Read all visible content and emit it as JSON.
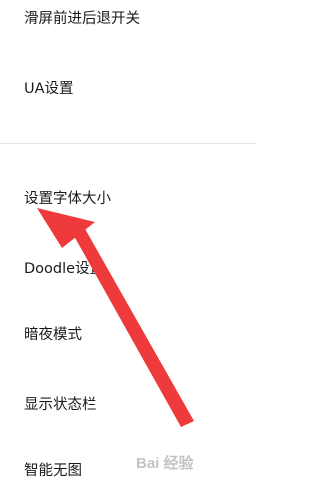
{
  "settings": {
    "items": [
      {
        "label": "滑屏前进后退开关"
      },
      {
        "label": "UA设置"
      },
      {
        "label": "设置字体大小"
      },
      {
        "label": "Doodle设置"
      },
      {
        "label": "暗夜模式"
      },
      {
        "label": "显示状态栏"
      },
      {
        "label": "智能无图"
      }
    ]
  },
  "annotation": {
    "color": "#ee3a3a",
    "target": "设置字体大小"
  },
  "watermark": {
    "text": "Bai 经验"
  }
}
